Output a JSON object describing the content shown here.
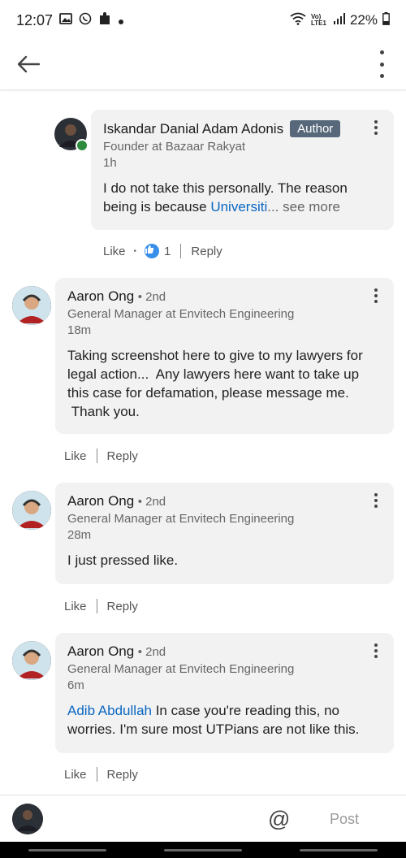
{
  "status_bar": {
    "time": "12:07",
    "signal_label": "Vo) LTE1",
    "battery": "22%"
  },
  "comments": [
    {
      "name": "Iskandar Danial Adam Adonis",
      "badge": "Author",
      "headline": "Founder at Bazaar Rakyat",
      "time": "1h",
      "body_text": "I do not take this personally. The reason being is because ",
      "body_link": "Universiti",
      "see_more": "... see more",
      "like_label": "Like",
      "reaction_count": "1",
      "reply_label": "Reply"
    },
    {
      "name": "Aaron Ong",
      "degree": "• 2nd",
      "headline": "General Manager at Envitech Engineering",
      "time": "18m",
      "body_text": "Taking screenshot here to give to my lawyers for legal action...  Any lawyers here want to take up this case for defamation, please message me.\n Thank you.",
      "like_label": "Like",
      "reply_label": "Reply"
    },
    {
      "name": "Aaron Ong",
      "degree": "• 2nd",
      "headline": "General Manager at Envitech Engineering",
      "time": "28m",
      "body_text": "I just pressed like.",
      "like_label": "Like",
      "reply_label": "Reply"
    },
    {
      "name": "Aaron Ong",
      "degree": "• 2nd",
      "headline": "General Manager at Envitech Engineering",
      "time": "6m",
      "mention": "Adib Abdullah",
      "body_text": " In case you're reading this, no worries.  I'm sure most UTPians are not like this.",
      "like_label": "Like",
      "reply_label": "Reply"
    }
  ],
  "composer": {
    "mention_symbol": "@",
    "post_label": "Post"
  },
  "colors": {
    "link": "#0a66c2",
    "author_badge": "#56687a",
    "bubble": "#f2f2f2",
    "online": "#2e8b3d"
  }
}
